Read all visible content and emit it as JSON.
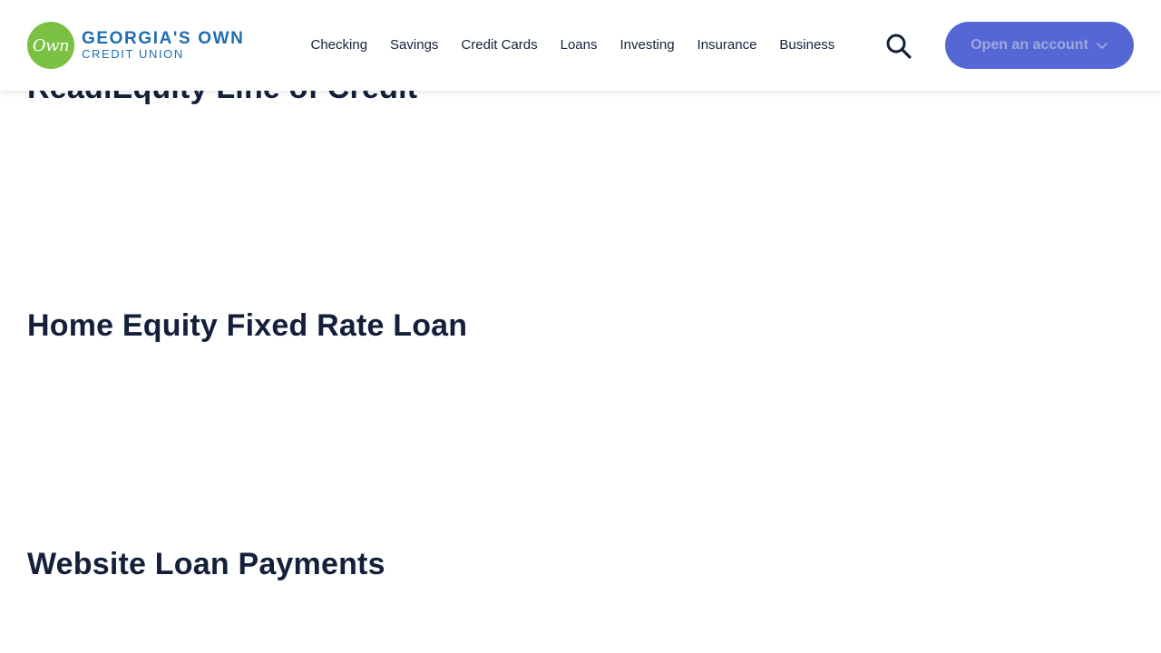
{
  "header": {
    "logo": {
      "badge_text": "Own",
      "line1": "GEORGIA'S OWN",
      "line2": "CREDIT UNION",
      "badge_color": "#7ac143",
      "text_color": "#1f6db3"
    },
    "nav": [
      {
        "label": "Checking"
      },
      {
        "label": "Savings"
      },
      {
        "label": "Credit Cards"
      },
      {
        "label": "Loans"
      },
      {
        "label": "Investing"
      },
      {
        "label": "Insurance"
      },
      {
        "label": "Business"
      }
    ],
    "search_icon": "search-icon",
    "cta": {
      "label": "Open an account",
      "icon": "chevron-down-icon",
      "color": "#5567d5"
    }
  },
  "sections": [
    {
      "title": "ReadiEquity Line of Credit"
    },
    {
      "title": "Home Equity Fixed Rate Loan"
    },
    {
      "title": "Website Loan Payments"
    }
  ]
}
